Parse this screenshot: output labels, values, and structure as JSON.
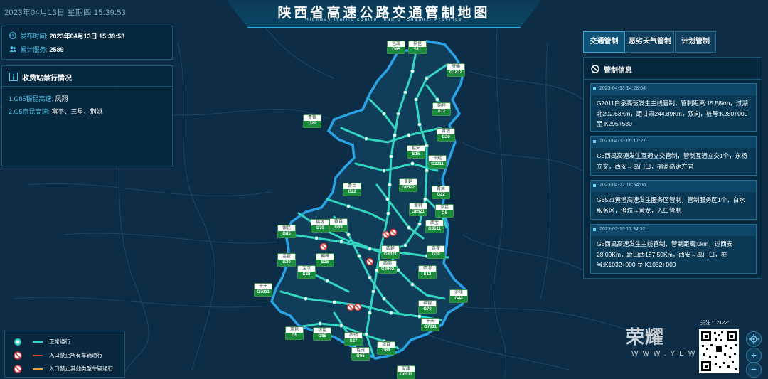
{
  "header": {
    "datetime": "2023年04月13日 星期四 15:39:53",
    "title": "陕西省高速公路交通管制地图",
    "subtitle": "Highway traffic control map of Shaanxi Province"
  },
  "info": {
    "publish_label": "发布时间:",
    "publish_value": "2023年04月13日 15:39:53",
    "service_label": "累计服务:",
    "service_value": "2589"
  },
  "closure": {
    "title": "收费站禁行情况",
    "items": [
      {
        "road": "1.G85银昆高速:",
        "detail": "凤翔"
      },
      {
        "road": "2.G5京昆高速:",
        "detail": "富平、三星、荆姚"
      }
    ]
  },
  "legend": {
    "items": [
      {
        "label": "正常通行",
        "color": "#2fd5c8"
      },
      {
        "label": "入口禁止所有车辆通行",
        "color": "#e03b3b"
      },
      {
        "label": "入口禁止其他类型车辆通行",
        "color": "#f0a135"
      }
    ]
  },
  "tabs": [
    {
      "label": "交通管制"
    },
    {
      "label": "恶劣天气管制"
    },
    {
      "label": "计划管制"
    }
  ],
  "control": {
    "title": "管制信息",
    "cards": [
      {
        "time": "2023-04-13 14:28:04",
        "text": "G7011白泉高速发生主线管制，管制距离:15.58km，过湖北202.63Km，距甘肃244.89Km，双向，桩号:K280+000 至 K295+580"
      },
      {
        "time": "2023-04-13 05:17:27",
        "text": "G5西禹高速发生互通立交管制，管制互通立交1个，东杨立交，西安→禹门口，榆蓝高速方向"
      },
      {
        "time": "2023-04-12 18:54:06",
        "text": "G6521黄澄高速发生服务区管制，管制服务区1个，白水服务区，澄城→黄龙，入口管制"
      },
      {
        "time": "2023-02-13 11:34:32",
        "text": "G5西禹高速发生主线管制，管制距离:0km，过西安28.00Km，距山西187.50Km，西安→禹门口，桩号:K1032+000 至 K1032+000"
      }
    ]
  },
  "map_labels": [
    {
      "name": "包茂",
      "code": "G65"
    },
    {
      "name": "神佳",
      "code": "S11"
    },
    {
      "name": "府榆",
      "code": "G1812"
    },
    {
      "name": "榆佳",
      "code": "S12"
    },
    {
      "name": "青银",
      "code": "G20"
    },
    {
      "name": "青银",
      "code": "G20"
    },
    {
      "name": "延安",
      "code": "S15"
    },
    {
      "name": "长延",
      "code": "G2211"
    },
    {
      "name": "黄延",
      "code": "G6522"
    },
    {
      "name": "青兰",
      "code": "G22"
    },
    {
      "name": "青兰",
      "code": "G22"
    },
    {
      "name": "黄韩",
      "code": "G6521"
    },
    {
      "name": "京昆",
      "code": "G5"
    },
    {
      "name": "西宝",
      "code": "G3511"
    },
    {
      "name": "福银",
      "code": "G70"
    },
    {
      "name": "银百",
      "code": "G69"
    },
    {
      "name": "银昆",
      "code": "G85"
    },
    {
      "name": "连霍",
      "code": "G30"
    },
    {
      "name": "麟峰",
      "code": "S25"
    },
    {
      "name": "西延",
      "code": "G3021"
    },
    {
      "name": "西商",
      "code": "G3002"
    },
    {
      "name": "连霍",
      "code": "G30"
    },
    {
      "name": "宝汉",
      "code": "S28"
    },
    {
      "name": "西渭",
      "code": "S13"
    },
    {
      "name": "十天",
      "code": "G7011"
    },
    {
      "name": "沪陕",
      "code": "G40"
    },
    {
      "name": "福银",
      "code": "G70"
    },
    {
      "name": "十天",
      "code": "G7011"
    },
    {
      "name": "京昆",
      "code": "G5"
    },
    {
      "name": "银昆",
      "code": "G85"
    },
    {
      "name": "西镇",
      "code": "S27"
    },
    {
      "name": "银百",
      "code": "G69"
    },
    {
      "name": "包茂",
      "code": "G65"
    },
    {
      "name": "安康",
      "code": "G6911"
    }
  ],
  "watermark": {
    "brand": "荣耀",
    "url": "WWW.YEWN",
    "follow": "关注 \"12122\""
  },
  "zoom": {
    "plus": "+",
    "minus": "−"
  }
}
